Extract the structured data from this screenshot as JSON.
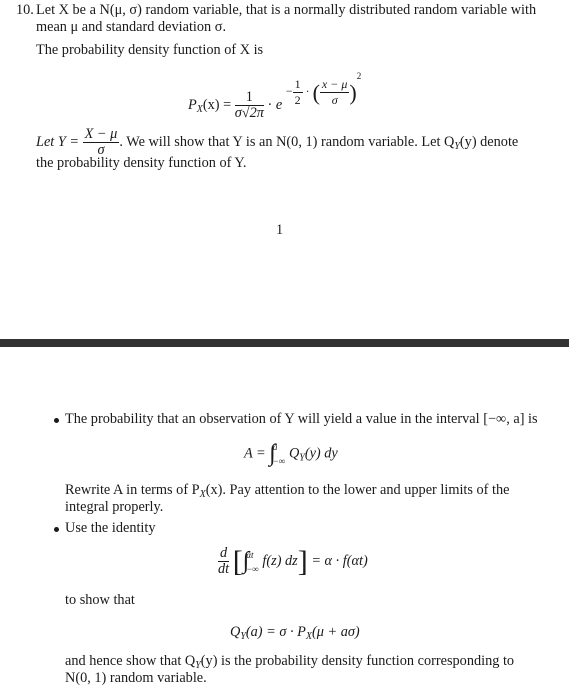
{
  "page1": {
    "item_number": "10.",
    "intro_line1": "Let X be a N(μ, σ) random variable, that is a normally distributed random variable with",
    "intro_line2": "mean μ and standard deviation σ.",
    "pdf_intro": "The probability density function of X is",
    "pdf_equation": {
      "lhs": "P",
      "lhs_sub": "X",
      "lhs_arg": "(x) =",
      "coef_num": "1",
      "coef_den": "σ√2π",
      "dot": "·",
      "base": "e",
      "exp_sign": "−",
      "exp_frac_num": "1",
      "exp_frac_den": "2",
      "exp_dot": "·",
      "inner_num": "x − μ",
      "inner_den": "σ",
      "power": "2"
    },
    "let_y_prefix": "Let Y =",
    "let_y_num": "X − μ",
    "let_y_den": "σ",
    "let_y_rest": ". We will show that Y is an N(0, 1) random variable. Let Q",
    "let_y_sub": "Y",
    "let_y_end": "(y) denote",
    "let_y_line2": "the probability density function of Y.",
    "page_number": "1"
  },
  "page2": {
    "bullet1_text": "The probability that an observation of Y will yield a value in the interval [−∞, a] is",
    "eq_a": {
      "lhs": "A =",
      "upper": "a",
      "lower": "−∞",
      "integrand": "Q",
      "integrand_sub": "Y",
      "integrand_rest": "(y) dy"
    },
    "rewrite_line1": "Rewrite A in terms of P",
    "rewrite_sub": "X",
    "rewrite_line1_end": "(x). Pay attention to the lower and upper limits of the",
    "rewrite_line2": "integral properly.",
    "bullet2_text": "Use the identity",
    "identity": {
      "d_num": "d",
      "d_den": "dt",
      "upper": "αt",
      "lower": "−∞",
      "integrand": "f(z) dz",
      "rhs": "= α · f(αt)"
    },
    "to_show": "to show that",
    "result_eq": {
      "lhs": "Q",
      "lhs_sub": "Y",
      "lhs_rest": "(a) = σ · P",
      "rhs_sub": "X",
      "rhs_rest": "(μ + aσ)"
    },
    "conclusion_line1_a": "and hence show that Q",
    "conclusion_sub": "Y",
    "conclusion_line1_b": "(y) is the probability density function corresponding to",
    "conclusion_line2": "N(0, 1) random variable."
  }
}
